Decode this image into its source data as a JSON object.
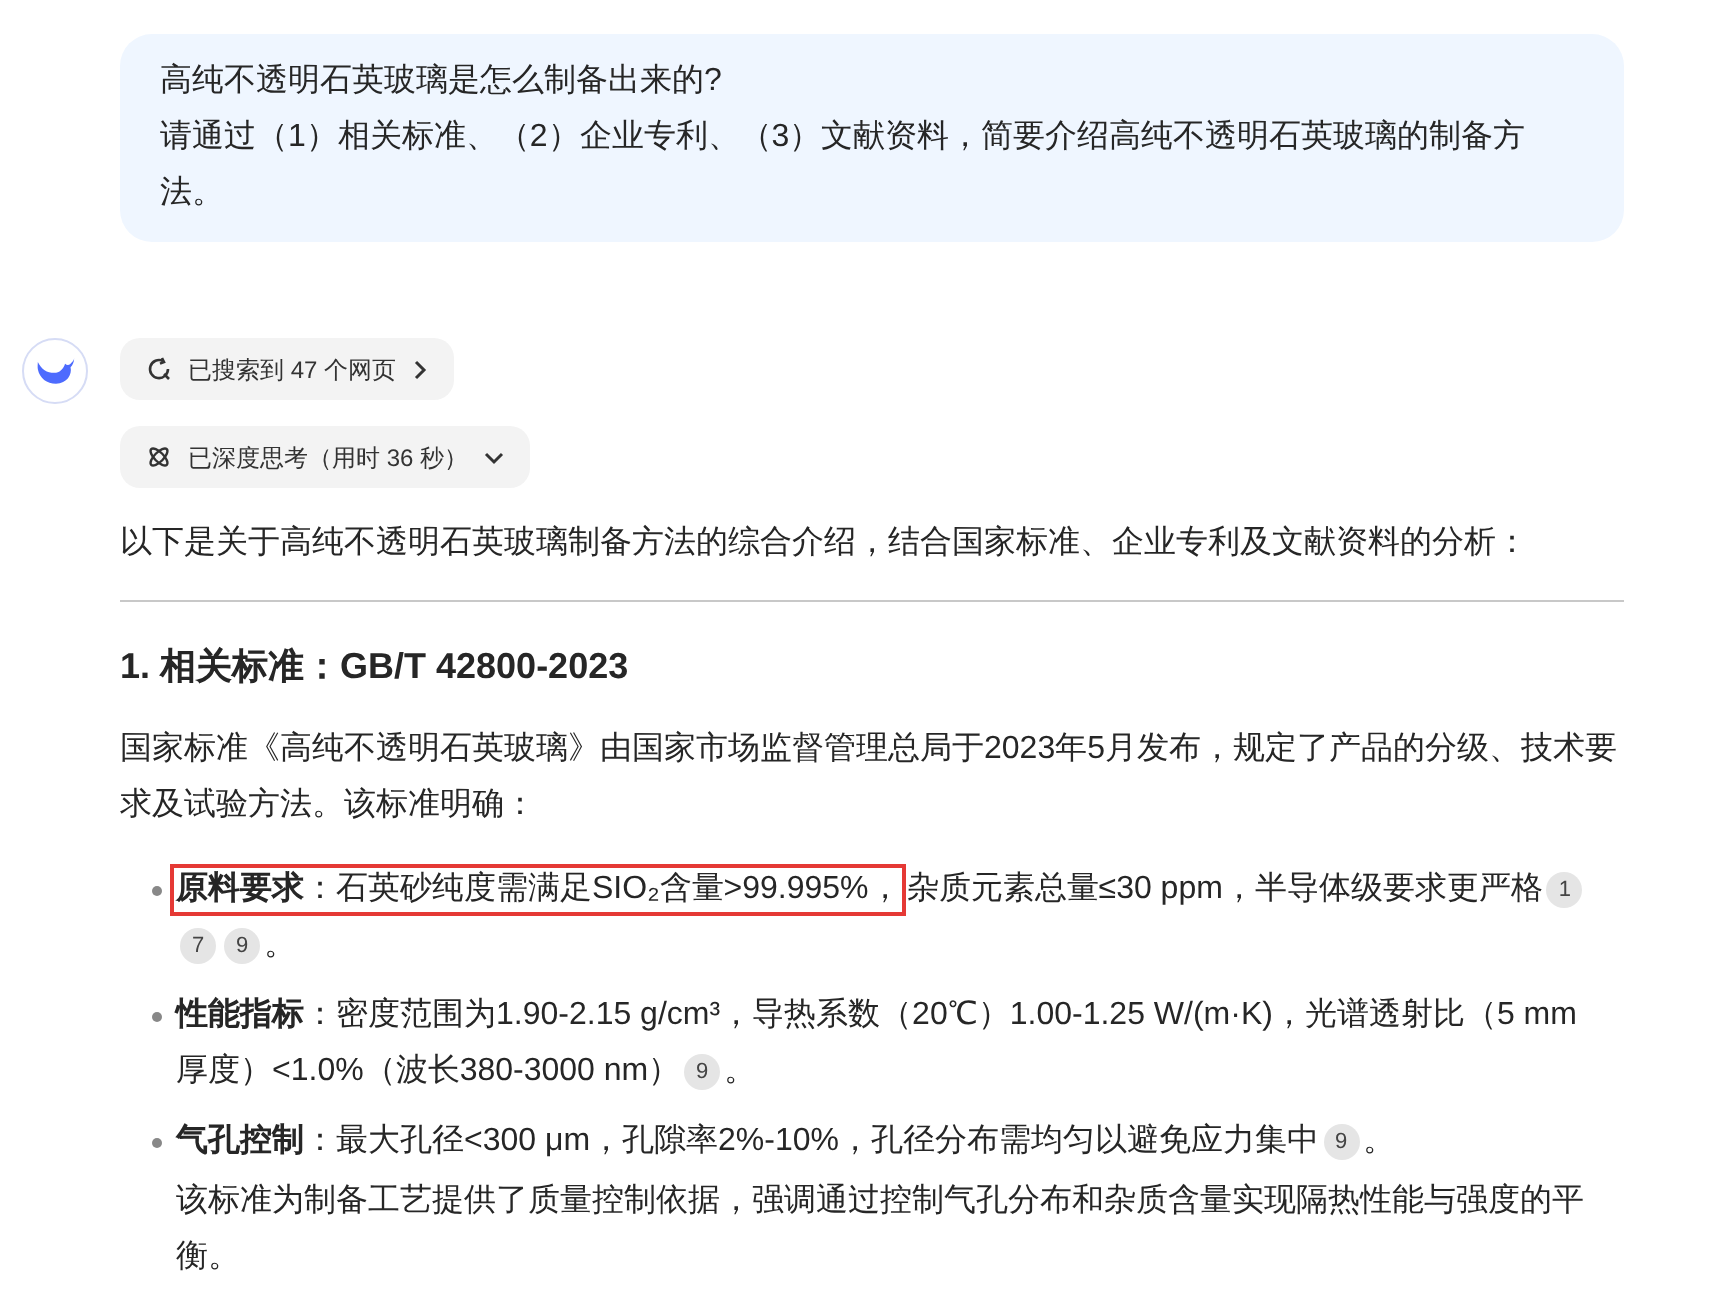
{
  "question": {
    "lines": [
      "高纯不透明石英玻璃是怎么制备出来的?",
      "请通过（1）相关标准、（2）企业专利、（3）文献资料，简要介绍高纯不透明石英玻璃的制备方法。"
    ]
  },
  "answer": {
    "chips": [
      {
        "kind": "search",
        "label": "已搜索到 47 个网页"
      },
      {
        "kind": "think",
        "label": "已深度思考（用时 36 秒）"
      }
    ],
    "intro": "以下是关于高纯不透明石英玻璃制备方法的综合介绍，结合国家标准、企业专利及文献资料的分析：",
    "section": {
      "heading": "1. 相关标准：GB/T 42800-2023",
      "paragraph": "国家标准《高纯不透明石英玻璃》由国家市场监督管理总局于2023年5月发布，规定了产品的分级、技术要求及试验方法。该标准明确：",
      "bullets": [
        {
          "lines": [
            [
              {
                "kind": "text",
                "text": "**原料要求**：石英砂纯度需满足SIO₂含量>99.995%，",
                "highlighted": true
              },
              {
                "kind": "text",
                "text": "杂质元素总量≤30 ppm，半导体级要求更严格",
                "highlighted": false
              },
              {
                "kind": "citation",
                "text": "1"
              }
            ],
            [
              {
                "kind": "citation",
                "text": "7"
              },
              {
                "kind": "citation",
                "text": "9"
              },
              {
                "kind": "text",
                "text": "。",
                "highlighted": false
              }
            ]
          ]
        },
        {
          "lines": [
            [
              {
                "kind": "text",
                "text": "**性能指标**：密度范围为1.90-2.15 g/cm³，导热系数（20℃）1.00-1.25 W/(m·K)，光谱透射比（5 mm",
                "highlighted": false
              }
            ],
            [
              {
                "kind": "text",
                "text": "厚度）<1.0%（波长380-3000 nm）",
                "highlighted": false
              },
              {
                "kind": "citation",
                "text": "9"
              },
              {
                "kind": "text",
                "text": "。",
                "highlighted": false
              }
            ]
          ]
        },
        {
          "lines": [
            [
              {
                "kind": "text",
                "text": "**气孔控制**：最大孔径<300 μm，孔隙率2%-10%，孔径分布需均匀以避免应力集中",
                "highlighted": false
              },
              {
                "kind": "citation",
                "text": "9"
              },
              {
                "kind": "text",
                "text": "。",
                "highlighted": false
              }
            ]
          ],
          "note": "该标准为制备工艺提供了质量控制依据，强调通过控制气孔分布和杂质含量实现隔热性能与强度的平衡。"
        }
      ]
    }
  }
}
